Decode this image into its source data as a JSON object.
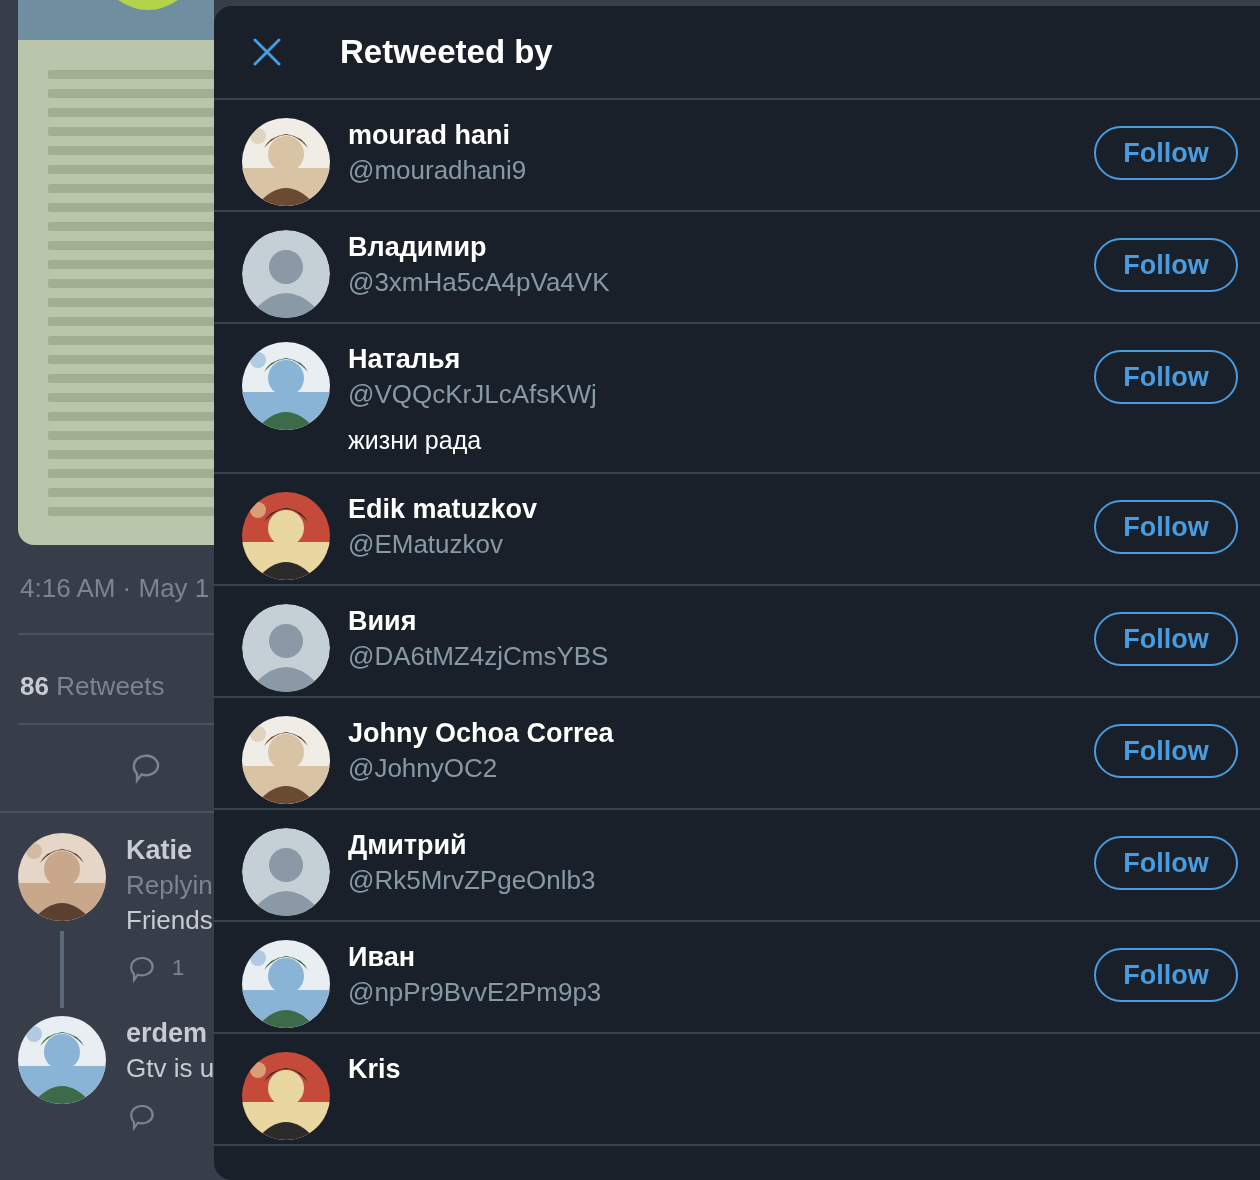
{
  "tweet": {
    "timestamp": "4:16 AM · May 1",
    "retweet_count": "86",
    "retweet_label": "Retweets"
  },
  "replies": [
    {
      "name": "Katie",
      "replying": "Replyin",
      "text": "Friends",
      "reply_count": "1"
    },
    {
      "name": "erdem",
      "text": "Gtv is u"
    }
  ],
  "modal": {
    "title": "Retweeted by",
    "users": [
      {
        "name": "mourad hani",
        "handle": "@mouradhani9",
        "follow": "Follow"
      },
      {
        "name": "Владимир",
        "handle": "@3xmHa5cA4pVa4VK",
        "kind": "default",
        "follow": "Follow"
      },
      {
        "name": "Наталья",
        "handle": "@VQQcKrJLcAfsKWj",
        "bio": "жизни рада",
        "follow": "Follow"
      },
      {
        "name": "Edik matuzkov",
        "handle": "@EMatuzkov",
        "follow": "Follow"
      },
      {
        "name": "Виия",
        "handle": "@DA6tMZ4zjCmsYBS",
        "kind": "default",
        "follow": "Follow"
      },
      {
        "name": "Johny Ochoa Correa",
        "handle": "@JohnyOC2",
        "follow": "Follow"
      },
      {
        "name": "Дмитрий",
        "handle": "@Rk5MrvZPgeOnlb3",
        "kind": "default",
        "follow": "Follow"
      },
      {
        "name": "Иван",
        "handle": "@npPr9BvvE2Pm9p3",
        "follow": "Follow"
      },
      {
        "name": "Kris"
      }
    ]
  }
}
